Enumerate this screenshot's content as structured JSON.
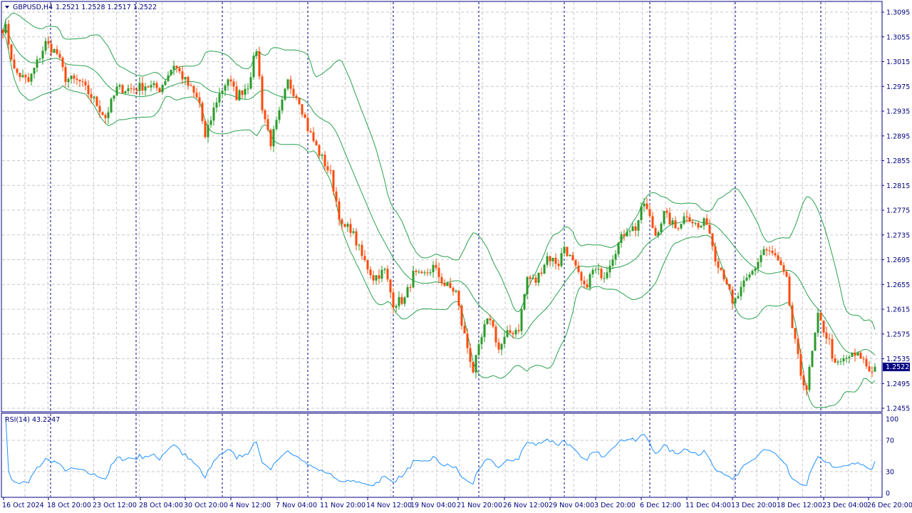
{
  "header": {
    "symbol": "GBPUSD,H4",
    "ohlc": "1.2521 1.2528 1.2517 1.2522"
  },
  "indicator": {
    "label": "RSI(14) 43.2247"
  },
  "colors": {
    "bull": "#2a9a2a",
    "bear": "#ff4a0a",
    "bands": "#2aa24f",
    "rsi": "#1e90ff",
    "axis": "#000080",
    "grid": "#c8c8c8",
    "separator": "#000080"
  },
  "chart_data": {
    "type": "candlestick",
    "title": "GBPUSD,H4",
    "symbol": "GBPUSD",
    "timeframe": "H4",
    "last_bar": {
      "open": 1.2521,
      "high": 1.2528,
      "low": 1.2517,
      "close": 1.2522
    },
    "current_price": "1.2522",
    "price_ticks": [
      "1.3095",
      "1.3055",
      "1.3015",
      "1.2975",
      "1.2935",
      "1.2895",
      "1.2855",
      "1.2815",
      "1.2775",
      "1.2735",
      "1.2695",
      "1.2655",
      "1.2615",
      "1.2575",
      "1.2535",
      "1.2495",
      "1.2455"
    ],
    "ylim": [
      1.2448,
      1.3115
    ],
    "time_ticks": [
      "16 Oct 2024",
      "18 Oct 20:00",
      "23 Oct 12:00",
      "28 Oct 04:00",
      "30 Oct 20:00",
      "4 Nov 12:00",
      "7 Nov 04:00",
      "11 Nov 20:00",
      "14 Nov 12:00",
      "19 Nov 04:00",
      "21 Nov 20:00",
      "26 Nov 12:00",
      "29 Nov 04:00",
      "3 Dec 20:00",
      "6 Dec 12:00",
      "11 Dec 04:00",
      "13 Dec 20:00",
      "18 Dec 12:00",
      "23 Dec 04:00",
      "26 Dec 20:00"
    ],
    "bar_count": 307,
    "close_path": [
      [
        1,
        1.3069
      ],
      [
        4,
        1.3
      ],
      [
        9,
        1.2982
      ],
      [
        15,
        1.3045
      ],
      [
        19,
        1.3028
      ],
      [
        22,
        1.2988
      ],
      [
        27,
        1.2982
      ],
      [
        32,
        1.2953
      ],
      [
        36,
        1.2925
      ],
      [
        40,
        1.2971
      ],
      [
        46,
        1.2971
      ],
      [
        50,
        1.2977
      ],
      [
        55,
        1.2971
      ],
      [
        60,
        1.3011
      ],
      [
        65,
        1.2977
      ],
      [
        69,
        1.2948
      ],
      [
        71,
        1.289
      ],
      [
        75,
        1.2953
      ],
      [
        79,
        1.2988
      ],
      [
        82,
        1.2959
      ],
      [
        86,
        1.2977
      ],
      [
        89,
        1.3036
      ],
      [
        91,
        1.2942
      ],
      [
        94,
        1.2884
      ],
      [
        97,
        1.293
      ],
      [
        100,
        1.2982
      ],
      [
        104,
        1.2953
      ],
      [
        107,
        1.2907
      ],
      [
        111,
        1.2867
      ],
      [
        115,
        1.2833
      ],
      [
        119,
        1.2746
      ],
      [
        122,
        1.2746
      ],
      [
        126,
        1.27
      ],
      [
        130,
        1.2666
      ],
      [
        134,
        1.2677
      ],
      [
        137,
        1.2625
      ],
      [
        141,
        1.2631
      ],
      [
        144,
        1.2671
      ],
      [
        147,
        1.2666
      ],
      [
        151,
        1.2683
      ],
      [
        155,
        1.2654
      ],
      [
        159,
        1.2643
      ],
      [
        161,
        1.2591
      ],
      [
        165,
        1.2516
      ],
      [
        169,
        1.2585
      ],
      [
        171,
        1.2602
      ],
      [
        174,
        1.255
      ],
      [
        177,
        1.2574
      ],
      [
        181,
        1.2585
      ],
      [
        184,
        1.2666
      ],
      [
        187,
        1.266
      ],
      [
        191,
        1.27
      ],
      [
        195,
        1.2689
      ],
      [
        197,
        1.2717
      ],
      [
        200,
        1.2689
      ],
      [
        204,
        1.2648
      ],
      [
        207,
        1.2677
      ],
      [
        211,
        1.2671
      ],
      [
        215,
        1.2712
      ],
      [
        219,
        1.2746
      ],
      [
        222,
        1.2746
      ],
      [
        225,
        1.2787
      ],
      [
        229,
        1.2735
      ],
      [
        232,
        1.2769
      ],
      [
        236,
        1.2746
      ],
      [
        240,
        1.2769
      ],
      [
        244,
        1.2746
      ],
      [
        247,
        1.2758
      ],
      [
        250,
        1.27
      ],
      [
        254,
        1.266
      ],
      [
        256,
        1.262
      ],
      [
        260,
        1.2654
      ],
      [
        264,
        1.2683
      ],
      [
        267,
        1.2712
      ],
      [
        271,
        1.27
      ],
      [
        275,
        1.266
      ],
      [
        277,
        1.2585
      ],
      [
        280,
        1.251
      ],
      [
        282,
        1.2487
      ],
      [
        286,
        1.2602
      ],
      [
        290,
        1.2562
      ],
      [
        292,
        1.2522
      ],
      [
        297,
        1.2539
      ],
      [
        301,
        1.2539
      ],
      [
        304,
        1.2516
      ],
      [
        306,
        1.2522
      ]
    ],
    "bollinger": {
      "period": 20,
      "deviations": 2
    },
    "rsi": {
      "period": 14,
      "value": 43.2247,
      "levels": [
        30,
        70
      ],
      "ticks": [
        "100",
        "70",
        "30",
        "0"
      ],
      "ylim": [
        0,
        100
      ]
    },
    "grid": true
  }
}
